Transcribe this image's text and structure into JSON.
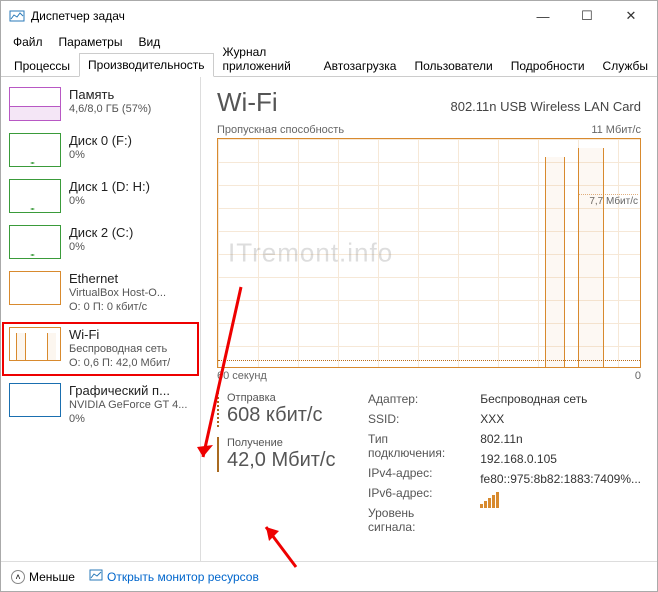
{
  "window": {
    "title": "Диспетчер задач"
  },
  "menu": {
    "file": "Файл",
    "options": "Параметры",
    "view": "Вид"
  },
  "tabs": {
    "processes": "Процессы",
    "performance": "Производительность",
    "apphistory": "Журнал приложений",
    "startup": "Автозагрузка",
    "users": "Пользователи",
    "details": "Подробности",
    "services": "Службы"
  },
  "sidebar": [
    {
      "kind": "mem",
      "name": "Память",
      "sub": "4,6/8,0 ГБ (57%)",
      "sub2": ""
    },
    {
      "kind": "disk",
      "name": "Диск 0 (F:)",
      "sub": "0%",
      "sub2": ""
    },
    {
      "kind": "disk",
      "name": "Диск 1 (D: H:)",
      "sub": "0%",
      "sub2": ""
    },
    {
      "kind": "disk",
      "name": "Диск 2 (C:)",
      "sub": "0%",
      "sub2": ""
    },
    {
      "kind": "eth",
      "name": "Ethernet",
      "sub": "VirtualBox Host-O...",
      "sub2": "О: 0 П: 0 кбит/с"
    },
    {
      "kind": "wifi",
      "name": "Wi-Fi",
      "sub": "Беспроводная сеть",
      "sub2": "О: 0,6 П: 42,0 Мбит/"
    },
    {
      "kind": "gpu",
      "name": "Графический п...",
      "sub": "NVIDIA GeForce GT 4...",
      "sub2": "0%"
    }
  ],
  "main": {
    "title": "Wi-Fi",
    "adapter": "802.11n USB Wireless LAN Card",
    "chart_label": "Пропускная способность",
    "chart_max": "11 Мбит/с",
    "chart_half": "7,7 Мбит/с",
    "chart_time": "60 секунд",
    "chart_zero": "0",
    "watermark": "ITremont.info",
    "send_label": "Отправка",
    "send_value": "608 кбит/с",
    "recv_label": "Получение",
    "recv_value": "42,0 Мбит/с",
    "details": {
      "adapter_k": "Адаптер:",
      "adapter_v": "Беспроводная сеть",
      "ssid_k": "SSID:",
      "ssid_v": "XXX",
      "conn_k": "Тип подключения:",
      "conn_v": "802.11n",
      "ipv4_k": "IPv4-адрес:",
      "ipv4_v": "192.168.0.105",
      "ipv6_k": "IPv6-адрес:",
      "ipv6_v": "fe80::975:8b82:1883:7409%...",
      "signal_k": "Уровень сигнала:"
    }
  },
  "footer": {
    "fewer": "Меньше",
    "resmon": "Открыть монитор ресурсов"
  },
  "chart_data": {
    "type": "line",
    "title": "Пропускная способность",
    "ylabel": "Мбит/с",
    "ylim": [
      0,
      11
    ],
    "x_seconds": 60,
    "series": [
      {
        "name": "Отправка",
        "approx_values_mbps": [
          0.3,
          0.3,
          0.3,
          0.3,
          0.3,
          0.3,
          0.3,
          0.3,
          0.3,
          0.5,
          0.5,
          0.6
        ]
      },
      {
        "name": "Получение",
        "approx_values_mbps": [
          0.2,
          0.2,
          0.2,
          0.2,
          0.2,
          0.2,
          0.2,
          0.2,
          0.2,
          10.2,
          0.2,
          10.6
        ]
      }
    ],
    "annotations": [
      "7,7 Мбит/с"
    ]
  }
}
